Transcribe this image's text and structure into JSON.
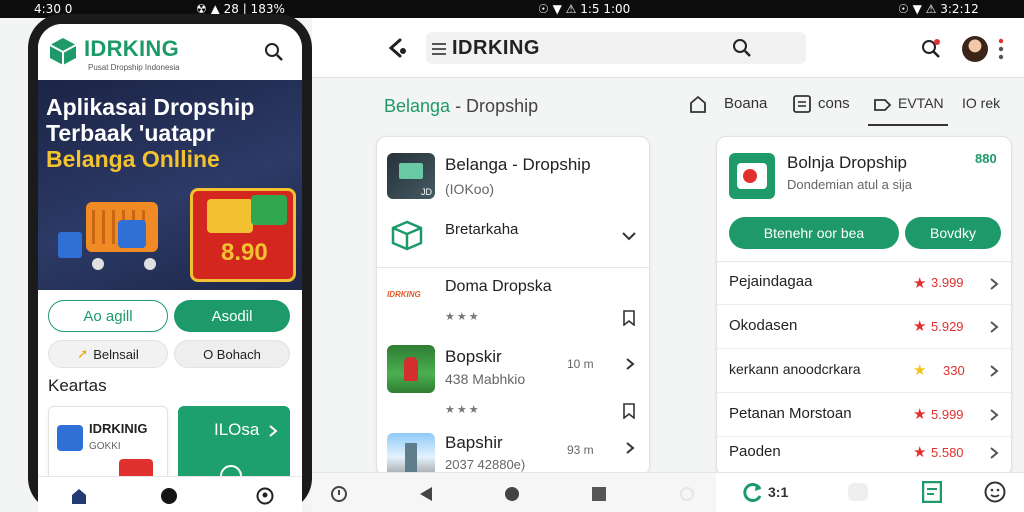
{
  "status_bar": {
    "left_time": "4:30 0",
    "left_icons": "☢ ▲ 28 | 183%",
    "mid_icons": "☉ ▼ ⚠ 1:5 1:00",
    "right": "☉ ▼ ⚠ 3:2:12"
  },
  "phone": {
    "app_name": "IDRKING",
    "app_tagline": "Pusat Dropship Indonesia",
    "banner_line1": "Aplikasai Dropship",
    "banner_line2": "Terbaak 'uatapr",
    "banner_line3": "Belanga Onlline",
    "banner_price": "8.90",
    "btn_outline": "Ao agill",
    "btn_green": "Asodil",
    "chip_1": "Belnsail",
    "chip_2": "O Bohach",
    "section_title": "Keartas",
    "card_title": "IDRKINIG",
    "card_sub": "GOKKI",
    "green_card_label": "ILOsa"
  },
  "tablet": {
    "app_name": "IDRKING",
    "breadcrumb_green": "Belanga",
    "breadcrumb_rest": " - Dropship",
    "tabs": [
      {
        "label": "Boana",
        "icon": "home-icon"
      },
      {
        "label": "cons",
        "icon": "list-icon"
      },
      {
        "label": "EVTAN",
        "icon": "tag-icon"
      },
      {
        "label": "IO rek",
        "icon": ""
      }
    ],
    "list": [
      {
        "title": "Belanga - Dropship",
        "sub": "(IOKoo)",
        "meta": "",
        "thumb_label": "JD"
      },
      {
        "title": "Bretarkaha",
        "sub": "",
        "meta": "",
        "thumb_label": ""
      },
      {
        "title": "Doma Dropska",
        "sub": "★★★",
        "meta": "",
        "thumb_label": "IDRKING"
      },
      {
        "title": "Bopskir",
        "sub": "438 Mabhkio",
        "meta": "10 m",
        "thumb_label": ""
      },
      {
        "title": "",
        "sub": "★★★",
        "meta": "",
        "thumb_label": ""
      },
      {
        "title": "Bapshir",
        "sub": "2037 42880e)",
        "meta": "93 m",
        "thumb_label": ""
      }
    ],
    "detail": {
      "title": "Bolnja Dropship",
      "subtitle": "Dondemian atul a sija",
      "badge": "880",
      "btn_primary": "Btenehr oor bea",
      "btn_secondary": "Bovdky",
      "rows": [
        {
          "label": "Pejaindagaa",
          "price": "3.999",
          "star_color": "#e0312e"
        },
        {
          "label": "Okodasen",
          "price": "5.929",
          "star_color": "#e0312e"
        },
        {
          "label": "kerkann anoodcrkara",
          "price": "330",
          "star_color": "#f0c419"
        },
        {
          "label": "Petanan Morstoan",
          "price": "5.999",
          "star_color": "#e0312e"
        },
        {
          "label": "Paoden",
          "price": "5.580",
          "star_color": "#e0312e"
        }
      ],
      "bottom_label": "3:1"
    }
  },
  "colors": {
    "accent": "#1e9a6a",
    "accent_dark": "#158a5c",
    "star_red": "#e0312e",
    "star_yellow": "#f0c419"
  }
}
